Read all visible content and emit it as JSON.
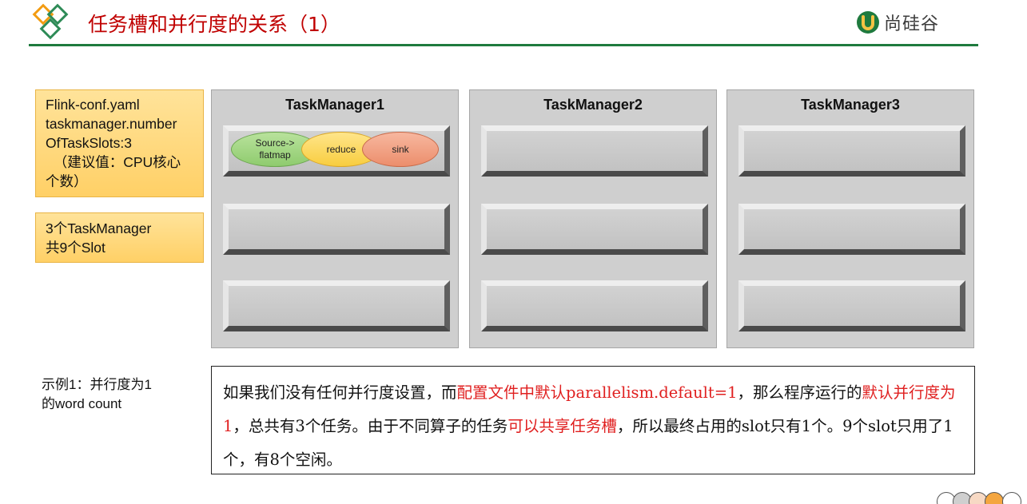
{
  "header": {
    "title": "任务槽和并行度的关系（1）",
    "brand": "尚硅谷",
    "colors": {
      "title": "#c00000",
      "rule": "#1f7a3e",
      "diamond_orange": "#f39c12",
      "diamond_green": "#2e8b57"
    }
  },
  "config_box": {
    "lines": [
      "Flink-conf.yaml",
      "taskmanager.number",
      "OfTaskSlots:3",
      "  （建议值：CPU核心",
      "个数）"
    ]
  },
  "summary_box": {
    "lines": [
      "3个TaskManager",
      "共9个Slot"
    ]
  },
  "task_managers": [
    {
      "name": "TaskManager1"
    },
    {
      "name": "TaskManager2"
    },
    {
      "name": "TaskManager3"
    }
  ],
  "tasks": {
    "source": [
      "Source->",
      "flatmap"
    ],
    "reduce": "reduce",
    "sink": "sink"
  },
  "example": {
    "lines": [
      "示例1：并行度为1",
      "的word count"
    ]
  },
  "description": {
    "p1": "如果我们没有任何并行度设置，而",
    "p2": "配置文件中默认parallelism.default=1",
    "p3": "，那么程序运行的",
    "p4": "默认并行度为1",
    "p5": "，总共有3个任务。由于不同算子的任务",
    "p6": "可以共享任务槽",
    "p7": "，所以最终占用的slot只有1个。9个slot只用了1个，有8个空闲。"
  }
}
